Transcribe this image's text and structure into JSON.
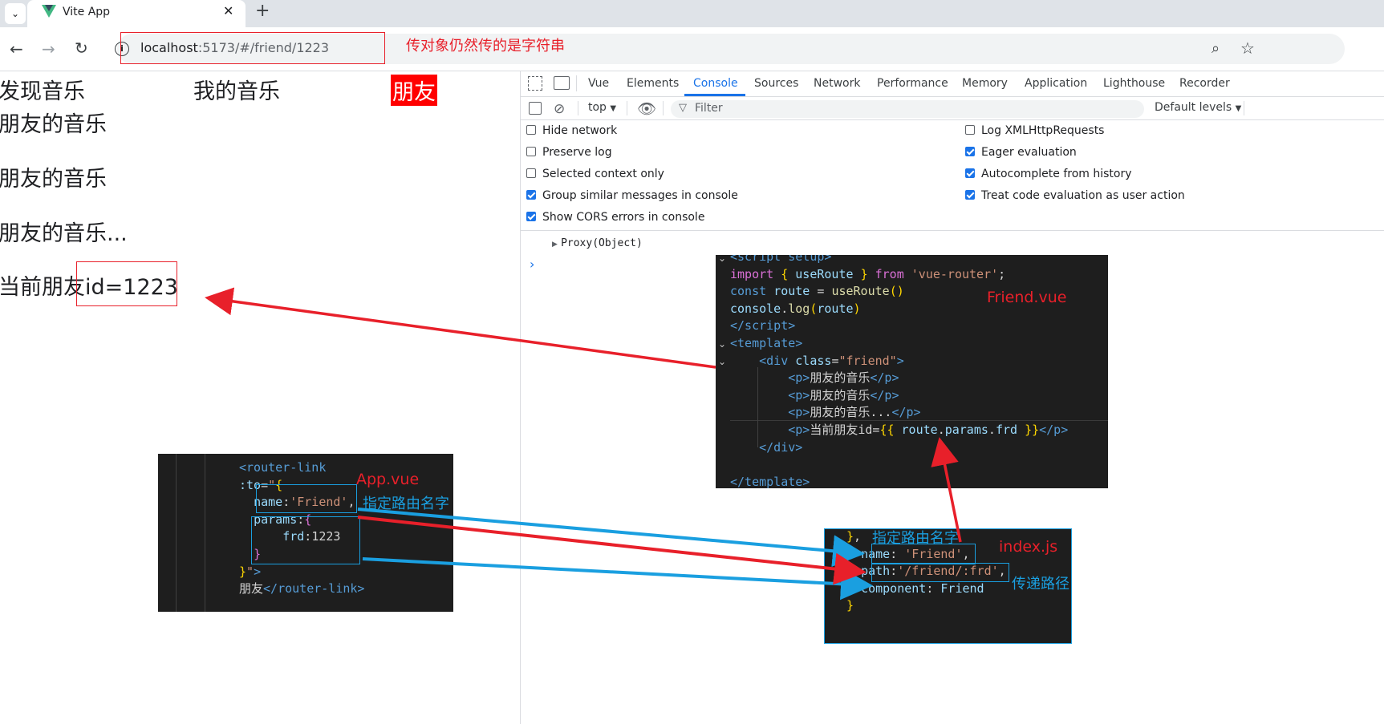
{
  "browser": {
    "tab_title": "Vite App",
    "url_host": "localhost",
    "url_rest": ":5173/#/friend/1223"
  },
  "annotations": {
    "url_note": "传对象仍然传的是字符串",
    "friend_vue": "Friend.vue",
    "app_vue": "App.vue",
    "index_js": "index.js",
    "name_note_1": "指定路由名字",
    "name_note_2": "指定路由名字",
    "path_note": "传递路径",
    "colors": {
      "red": "#e8202a",
      "blue": "#1a9fe0"
    }
  },
  "page": {
    "nav": [
      "发现音乐",
      "我的音乐",
      "朋友"
    ],
    "paragraphs": [
      "朋友的音乐",
      "朋友的音乐",
      "朋友的音乐..."
    ],
    "current_prefix": "当前朋友",
    "current_id": "id=1223"
  },
  "devtools": {
    "tabs": [
      "Vue",
      "Elements",
      "Console",
      "Sources",
      "Network",
      "Performance",
      "Memory",
      "Application",
      "Lighthouse",
      "Recorder"
    ],
    "active_tab": "Console",
    "context": "top",
    "filter_placeholder": "Filter",
    "levels": "Default levels",
    "options_left": [
      {
        "label": "Hide network",
        "checked": false
      },
      {
        "label": "Preserve log",
        "checked": false
      },
      {
        "label": "Selected context only",
        "checked": false
      },
      {
        "label": "Group similar messages in console",
        "checked": true
      },
      {
        "label": "Show CORS errors in console",
        "checked": true
      }
    ],
    "options_right": [
      {
        "label": "Log XMLHttpRequests",
        "checked": false
      },
      {
        "label": "Eager evaluation",
        "checked": true
      },
      {
        "label": "Autocomplete from history",
        "checked": true
      },
      {
        "label": "Treat code evaluation as user action",
        "checked": true
      }
    ],
    "log": "Proxy(Object)"
  }
}
